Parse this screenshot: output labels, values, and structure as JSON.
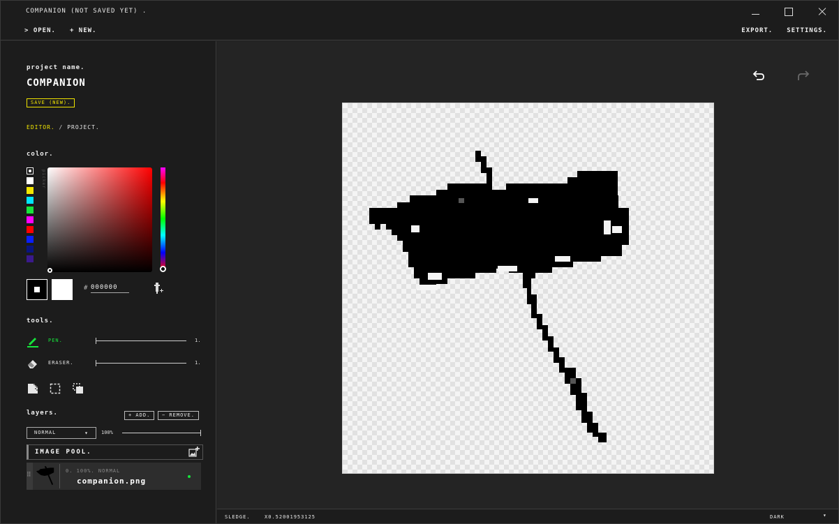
{
  "window": {
    "title": "COMPANION (NOT SAVED YET) ."
  },
  "menu": {
    "open": "> OPEN.",
    "new": "+ NEW.",
    "export": "EXPORT.",
    "settings": "SETTINGS."
  },
  "sidebar": {
    "project_label": "project name.",
    "project_name": "COMPANION",
    "save_label": "SAVE (NEW).",
    "crumb_active": "EDITOR.",
    "crumb_sep": "/",
    "crumb_link": "PROJECT.",
    "color_label": "color.",
    "picker_tag": "picker",
    "swatches": [
      "#000000",
      "#ffffff",
      "#f2e600",
      "#00e5ff",
      "#16e53b",
      "#ff00ff",
      "#ff0000",
      "#0a1fff",
      "#0a1480",
      "#3a1a8c"
    ],
    "hex_hash": "#",
    "hex_value": "000000",
    "tools_label": "tools.",
    "pen_label": "PEN.",
    "pen_size": "1.",
    "eraser_label": "ERASER.",
    "eraser_size": "1.",
    "layers_label": "layers.",
    "add_label": "+ ADD.",
    "remove_label": "− REMOVE.",
    "blend_mode": "NORMAL",
    "opacity": "100%",
    "pool_title": "IMAGE POOL.",
    "layer": {
      "meta": "0.  100%. NORMAL",
      "name": "companion.png"
    }
  },
  "colors": {
    "accent_yellow": "#f2e600",
    "accent_green": "#16e53b",
    "active_dot": "#16e53b"
  },
  "icons": {
    "undo": "undo-icon",
    "redo": "redo-icon",
    "eyedropper": "eyedropper-icon",
    "pen": "pen-icon",
    "eraser": "eraser-icon",
    "fill": "fill-icon",
    "select": "selection-icon",
    "stamp": "stamp-icon",
    "add_image": "add-image-icon"
  },
  "status": {
    "tool": "SLEDGE.",
    "zoom": "X0.52001953125",
    "theme": "DARK"
  }
}
